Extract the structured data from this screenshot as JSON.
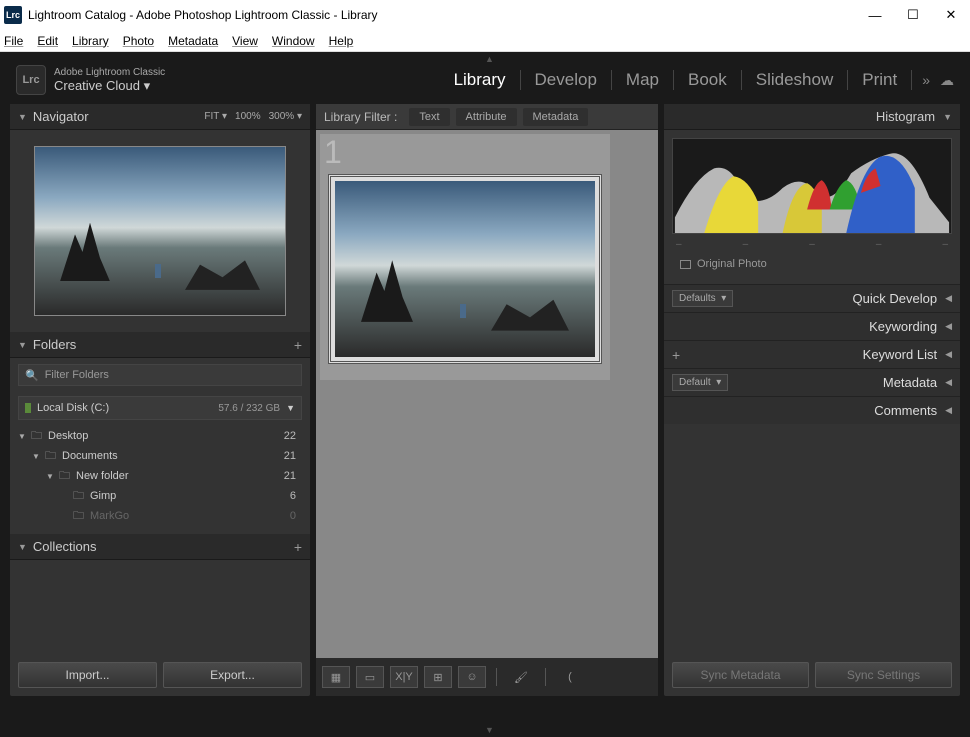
{
  "titlebar": {
    "title": "Lightroom Catalog - Adobe Photoshop Lightroom Classic - Library"
  },
  "menubar": [
    "File",
    "Edit",
    "Library",
    "Photo",
    "Metadata",
    "View",
    "Window",
    "Help"
  ],
  "brand": {
    "line1": "Adobe Lightroom Classic",
    "line2": "Creative Cloud ▾"
  },
  "modules": [
    "Library",
    "Develop",
    "Map",
    "Book",
    "Slideshow",
    "Print"
  ],
  "activeModule": "Library",
  "navigator": {
    "title": "Navigator",
    "fit": "FIT ▾",
    "z100": "100%",
    "z300": "300% ▾"
  },
  "folders": {
    "title": "Folders",
    "filterPlaceholder": "Filter Folders",
    "disk": {
      "name": "Local Disk (C:)",
      "size": "57.6 / 232 GB"
    },
    "tree": [
      {
        "name": "Desktop",
        "count": "22",
        "indent": 0
      },
      {
        "name": "Documents",
        "count": "21",
        "indent": 1
      },
      {
        "name": "New folder",
        "count": "21",
        "indent": 2
      },
      {
        "name": "Gimp",
        "count": "6",
        "indent": 3,
        "leaf": true
      },
      {
        "name": "MarkGo",
        "count": "0",
        "indent": 3,
        "leaf": true,
        "dim": true
      }
    ]
  },
  "collections": {
    "title": "Collections"
  },
  "buttons": {
    "import": "Import...",
    "export": "Export..."
  },
  "libraryFilter": {
    "label": "Library Filter :",
    "tabs": [
      "Text",
      "Attribute",
      "Metadata"
    ]
  },
  "thumbNum": "1",
  "histogram": {
    "title": "Histogram",
    "original": "Original Photo"
  },
  "rightPanels": [
    {
      "left": "Defaults",
      "title": "Quick Develop"
    },
    {
      "left": null,
      "title": "Keywording"
    },
    {
      "left": null,
      "title": "Keyword List",
      "plus": true
    },
    {
      "left": "Default",
      "title": "Metadata"
    },
    {
      "left": null,
      "title": "Comments"
    }
  ],
  "sync": {
    "meta": "Sync Metadata",
    "settings": "Sync Settings"
  }
}
